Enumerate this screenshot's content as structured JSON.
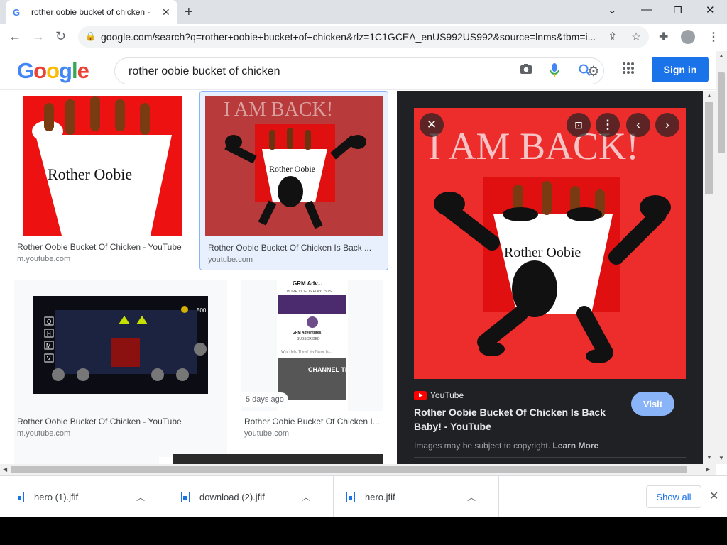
{
  "browser": {
    "tab_title": "rother oobie bucket of chicken -",
    "tab_favicon": "G",
    "tab_close": "✕",
    "new_tab": "+",
    "url": "google.com/search?q=rother+oobie+bucket+of+chicken&rlz=1C1GCEA_enUS992US992&source=lnms&tbm=i..."
  },
  "google": {
    "logo_letters": [
      "G",
      "o",
      "o",
      "g",
      "l",
      "e"
    ],
    "logo_colors": [
      "#4285f4",
      "#ea4335",
      "#fbbc05",
      "#4285f4",
      "#34a853",
      "#ea4335"
    ],
    "query": "rother oobie bucket of chicken",
    "signin_label": "Sign in"
  },
  "results": [
    {
      "title": "Rother Oobie Bucket Of Chicken - YouTube",
      "source": "m.youtube.com",
      "thumb_text": "Rother Oobie"
    },
    {
      "title": "Rother Oobie Bucket Of Chicken Is Back ...",
      "source": "youtube.com",
      "thumb_headline": "I AM BACK!",
      "thumb_text": "Rother Oobie"
    },
    {
      "title": "Rother Oobie Bucket Of Chicken - YouTube",
      "source": "m.youtube.com",
      "thumb_counter": "500",
      "thumb_keys": [
        "Q",
        "H",
        "M",
        "V"
      ]
    },
    {
      "title": "Rother Oobie Bucket Of Chicken I...",
      "source": "youtube.com",
      "badge": "5 days ago",
      "thumb_channel": "GRM Adv...",
      "thumb_nav": "HOME  VIDEOS  PLAYLISTS",
      "thumb_channel_full": "GRM Adventures",
      "thumb_subscribed": "SUBSCRIBED",
      "thumb_sub": "Why Hello There! My Name Is...",
      "thumb_trailer": "CHANNEL TRAILER"
    }
  ],
  "preview": {
    "headline": "I AM BACK!",
    "image_text": "Rother Oobie",
    "source": "YouTube",
    "title": "Rother Oobie Bucket Of Chicken Is Back Baby! - YouTube",
    "visit_label": "Visit",
    "copyright": "Images may be subject to copyright.",
    "learn_more": "Learn More"
  },
  "downloads": {
    "items": [
      {
        "name": "hero (1).jfif"
      },
      {
        "name": "download (2).jfif"
      },
      {
        "name": "hero.jfif"
      }
    ],
    "show_all": "Show all"
  }
}
